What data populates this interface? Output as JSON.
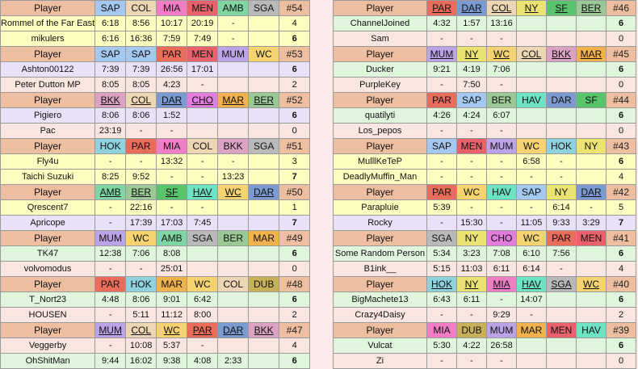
{
  "header_label": "Player",
  "colors": {
    "hdr": "#eebea0",
    "row_yellow": "#fdfdc0",
    "row_green": "#dff5dc",
    "row_lavender": "#e8e1f8",
    "row_pink": "#f9e6e0",
    "team": {
      "SAP": "#a4c8f0",
      "COL": "#edd6b4",
      "MIA": "#f07dc6",
      "MEN": "#e8616b",
      "AMB": "#7fd6a3",
      "SGA": "#b9b9b9",
      "PAR": "#ea6d5b",
      "MUM": "#bca2e6",
      "WC": "#f4d370",
      "BKK": "#dca2c3",
      "DAR": "#7a9ad1",
      "CHO": "#e27cdd",
      "MAR": "#f1b24d",
      "BER": "#9bc996",
      "HOK": "#8ed2de",
      "SF": "#58c46c",
      "HAV": "#6ee3c4",
      "DUB": "#c7b058",
      "NY": "#ebe371"
    }
  },
  "left": [
    {
      "num": "#54",
      "teams": [
        {
          "n": "SAP",
          "u": false
        },
        {
          "n": "COL",
          "u": false
        },
        {
          "n": "MIA",
          "u": false
        },
        {
          "n": "MEN",
          "u": false
        },
        {
          "n": "AMB",
          "u": false
        },
        {
          "n": "SGA",
          "u": false
        }
      ],
      "rows": [
        {
          "name": "Rommel of the Far East",
          "bg": "row_yellow",
          "cells": [
            "6:18",
            "8:56",
            "10:17",
            "20:19",
            "-",
            ""
          ],
          "count": "4",
          "max": false
        },
        {
          "name": "mikulers",
          "bg": "row_yellow",
          "cells": [
            "6:16",
            "16:36",
            "7:59",
            "7:49",
            "-",
            ""
          ],
          "count": "6",
          "max": true
        }
      ]
    },
    {
      "num": "#53",
      "teams": [
        {
          "n": "SAP",
          "u": false
        },
        {
          "n": "SAP",
          "u": false
        },
        {
          "n": "PAR",
          "u": false
        },
        {
          "n": "MEN",
          "u": false
        },
        {
          "n": "MUM",
          "u": false
        },
        {
          "n": "WC",
          "u": false
        }
      ],
      "rows": [
        {
          "name": "Ashton00122",
          "bg": "row_lavender",
          "cells": [
            "7:39",
            "7:39",
            "26:56",
            "17:01",
            "",
            ""
          ],
          "count": "6",
          "max": true
        },
        {
          "name": "Peter Dutton MP",
          "bg": "row_pink",
          "cells": [
            "8:05",
            "8:05",
            "4:23",
            "-",
            "",
            ""
          ],
          "count": "2",
          "max": false
        }
      ]
    },
    {
      "num": "#52",
      "teams": [
        {
          "n": "BKK",
          "u": true
        },
        {
          "n": "COL",
          "u": true
        },
        {
          "n": "DAR",
          "u": true
        },
        {
          "n": "CHO",
          "u": true
        },
        {
          "n": "MAR",
          "u": true
        },
        {
          "n": "BER",
          "u": true
        }
      ],
      "rows": [
        {
          "name": "Pigiero",
          "bg": "row_lavender",
          "cells": [
            "8:06",
            "8:06",
            "1:52",
            "",
            "",
            ""
          ],
          "count": "6",
          "max": true
        },
        {
          "name": "Pac",
          "bg": "row_pink",
          "cells": [
            "23:19",
            "-",
            "-",
            "",
            "",
            ""
          ],
          "count": "0",
          "max": false
        }
      ]
    },
    {
      "num": "#51",
      "teams": [
        {
          "n": "HOK",
          "u": false
        },
        {
          "n": "PAR",
          "u": false
        },
        {
          "n": "MIA",
          "u": false
        },
        {
          "n": "COL",
          "u": false
        },
        {
          "n": "BKK",
          "u": false
        },
        {
          "n": "SGA",
          "u": false
        }
      ],
      "rows": [
        {
          "name": "Fly4u",
          "bg": "row_yellow",
          "cells": [
            "-",
            "-",
            "13:32",
            "-",
            "-",
            ""
          ],
          "count": "3",
          "max": false
        },
        {
          "name": "Taichi Suzuki",
          "bg": "row_yellow",
          "cells": [
            "8:25",
            "9:52",
            "-",
            "-",
            "13:23",
            ""
          ],
          "count": "7",
          "max": true
        }
      ]
    },
    {
      "num": "#50",
      "teams": [
        {
          "n": "AMB",
          "u": true
        },
        {
          "n": "BER",
          "u": true
        },
        {
          "n": "SF",
          "u": true
        },
        {
          "n": "HAV",
          "u": true
        },
        {
          "n": "WC",
          "u": true
        },
        {
          "n": "DAR",
          "u": true
        }
      ],
      "rows": [
        {
          "name": "Qrescent7",
          "bg": "row_yellow",
          "cells": [
            "-",
            "22:16",
            "-",
            "-",
            "",
            ""
          ],
          "count": "1",
          "max": false
        },
        {
          "name": "Apricope",
          "bg": "row_lavender",
          "cells": [
            "-",
            "17:39",
            "17:03",
            "7:45",
            "",
            ""
          ],
          "count": "7",
          "max": true
        }
      ]
    },
    {
      "num": "#49",
      "teams": [
        {
          "n": "MUM",
          "u": false
        },
        {
          "n": "WC",
          "u": false
        },
        {
          "n": "AMB",
          "u": false
        },
        {
          "n": "SGA",
          "u": false
        },
        {
          "n": "BER",
          "u": false
        },
        {
          "n": "MAR",
          "u": false
        }
      ],
      "rows": [
        {
          "name": "TK47",
          "bg": "row_green",
          "cells": [
            "12:38",
            "7:06",
            "8:08",
            "",
            "",
            ""
          ],
          "count": "6",
          "max": true
        },
        {
          "name": "volvomodus",
          "bg": "row_pink",
          "cells": [
            "-",
            "-",
            "25:01",
            "",
            "",
            ""
          ],
          "count": "0",
          "max": false
        }
      ]
    },
    {
      "num": "#48",
      "teams": [
        {
          "n": "PAR",
          "u": false
        },
        {
          "n": "HOK",
          "u": false
        },
        {
          "n": "MAR",
          "u": false
        },
        {
          "n": "WC",
          "u": false
        },
        {
          "n": "COL",
          "u": false
        },
        {
          "n": "DUB",
          "u": false
        }
      ],
      "rows": [
        {
          "name": "T_Nort23",
          "bg": "row_green",
          "cells": [
            "4:48",
            "8:06",
            "9:01",
            "6:42",
            "",
            ""
          ],
          "count": "6",
          "max": true
        },
        {
          "name": "HOUSEN",
          "bg": "row_pink",
          "cells": [
            "-",
            "5:11",
            "11:12",
            "8:00",
            "",
            ""
          ],
          "count": "2",
          "max": false
        }
      ]
    },
    {
      "num": "#47",
      "teams": [
        {
          "n": "MUM",
          "u": true
        },
        {
          "n": "COL",
          "u": true
        },
        {
          "n": "WC",
          "u": true
        },
        {
          "n": "PAR",
          "u": true
        },
        {
          "n": "DAR",
          "u": true
        },
        {
          "n": "BKK",
          "u": true
        }
      ],
      "rows": [
        {
          "name": "Veggerby",
          "bg": "row_pink",
          "cells": [
            "-",
            "10:08",
            "5:37",
            "-",
            "",
            ""
          ],
          "count": "4",
          "max": false
        },
        {
          "name": "OhShitMan",
          "bg": "row_green",
          "cells": [
            "9:44",
            "16:02",
            "9:38",
            "4:08",
            "2:33",
            ""
          ],
          "count": "6",
          "max": true
        }
      ]
    }
  ],
  "right": [
    {
      "num": "#46",
      "teams": [
        {
          "n": "PAR",
          "u": true
        },
        {
          "n": "DAR",
          "u": true
        },
        {
          "n": "COL",
          "u": true
        },
        {
          "n": "NY",
          "u": true
        },
        {
          "n": "SF",
          "u": true
        },
        {
          "n": "BER",
          "u": true
        }
      ],
      "rows": [
        {
          "name": "ChannelJoined",
          "bg": "row_green",
          "cells": [
            "4:32",
            "1:57",
            "13:16",
            "",
            "",
            ""
          ],
          "count": "6",
          "max": true
        },
        {
          "name": "Sam",
          "bg": "row_pink",
          "cells": [
            "-",
            "-",
            "-",
            "",
            "",
            ""
          ],
          "count": "0",
          "max": false
        }
      ]
    },
    {
      "num": "#45",
      "teams": [
        {
          "n": "MUM",
          "u": true
        },
        {
          "n": "NY",
          "u": true
        },
        {
          "n": "WC",
          "u": true
        },
        {
          "n": "COL",
          "u": true
        },
        {
          "n": "BKK",
          "u": true
        },
        {
          "n": "MAR",
          "u": true
        }
      ],
      "rows": [
        {
          "name": "Ducker",
          "bg": "row_green",
          "cells": [
            "9:21",
            "4:19",
            "7:06",
            "",
            "",
            ""
          ],
          "count": "6",
          "max": true
        },
        {
          "name": "PurpleKey",
          "bg": "row_pink",
          "cells": [
            "-",
            "7:50",
            "-",
            "",
            "",
            ""
          ],
          "count": "0",
          "max": false
        }
      ]
    },
    {
      "num": "#44",
      "teams": [
        {
          "n": "PAR",
          "u": false
        },
        {
          "n": "SAP",
          "u": false
        },
        {
          "n": "BER",
          "u": false
        },
        {
          "n": "HAV",
          "u": false
        },
        {
          "n": "DAR",
          "u": false
        },
        {
          "n": "SF",
          "u": false
        }
      ],
      "rows": [
        {
          "name": "quatilyti",
          "bg": "row_green",
          "cells": [
            "4:26",
            "4:24",
            "6:07",
            "",
            "",
            ""
          ],
          "count": "6",
          "max": true
        },
        {
          "name": "Los_pepos",
          "bg": "row_pink",
          "cells": [
            "-",
            "-",
            "-",
            "",
            "",
            ""
          ],
          "count": "0",
          "max": false
        }
      ]
    },
    {
      "num": "#43",
      "teams": [
        {
          "n": "SAP",
          "u": false
        },
        {
          "n": "MEN",
          "u": false
        },
        {
          "n": "MUM",
          "u": false
        },
        {
          "n": "WC",
          "u": false
        },
        {
          "n": "HOK",
          "u": false
        },
        {
          "n": "NY",
          "u": false
        }
      ],
      "rows": [
        {
          "name": "MulllKeTeP",
          "bg": "row_yellow",
          "cells": [
            "-",
            "-",
            "-",
            "6:58",
            "-",
            ""
          ],
          "count": "6",
          "max": true
        },
        {
          "name": "DeadlyMuffin_Man",
          "bg": "row_yellow",
          "cells": [
            "-",
            "-",
            "-",
            "-",
            "-",
            ""
          ],
          "count": "4",
          "max": false
        }
      ]
    },
    {
      "num": "#42",
      "teams": [
        {
          "n": "PAR",
          "u": false
        },
        {
          "n": "WC",
          "u": false
        },
        {
          "n": "HAV",
          "u": false
        },
        {
          "n": "SAP",
          "u": false
        },
        {
          "n": "NY",
          "u": false
        },
        {
          "n": "DAR",
          "u": true
        }
      ],
      "rows": [
        {
          "name": "Parapluie",
          "bg": "row_yellow",
          "cells": [
            "5:39",
            "-",
            "-",
            "-",
            "6:14",
            "-"
          ],
          "count": "5",
          "max": false
        },
        {
          "name": "Rocky",
          "bg": "row_lavender",
          "cells": [
            "-",
            "15:30",
            "-",
            "11:05",
            "9:33",
            "3:29"
          ],
          "count": "7",
          "max": true
        }
      ]
    },
    {
      "num": "#41",
      "teams": [
        {
          "n": "SGA",
          "u": false
        },
        {
          "n": "NY",
          "u": false
        },
        {
          "n": "CHO",
          "u": false
        },
        {
          "n": "WC",
          "u": false
        },
        {
          "n": "PAR",
          "u": false
        },
        {
          "n": "MEN",
          "u": false
        }
      ],
      "rows": [
        {
          "name": "Some Random Person",
          "bg": "row_green",
          "cells": [
            "5:34",
            "3:23",
            "7:08",
            "6:10",
            "7:56",
            ""
          ],
          "count": "6",
          "max": true
        },
        {
          "name": "B1ink__",
          "bg": "row_pink",
          "cells": [
            "5:15",
            "11:03",
            "6:11",
            "6:14",
            "-",
            ""
          ],
          "count": "4",
          "max": false
        }
      ]
    },
    {
      "num": "#40",
      "teams": [
        {
          "n": "HOK",
          "u": true
        },
        {
          "n": "NY",
          "u": true
        },
        {
          "n": "MIA",
          "u": true
        },
        {
          "n": "HAV",
          "u": true
        },
        {
          "n": "SGA",
          "u": true
        },
        {
          "n": "WC",
          "u": true
        }
      ],
      "rows": [
        {
          "name": "BigMachete13",
          "bg": "row_green",
          "cells": [
            "6:43",
            "6:11",
            "-",
            "14:07",
            "",
            ""
          ],
          "count": "6",
          "max": true
        },
        {
          "name": "Crazy4Daisy",
          "bg": "row_pink",
          "cells": [
            "-",
            "-",
            "9:29",
            "-",
            "",
            ""
          ],
          "count": "2",
          "max": false
        }
      ]
    },
    {
      "num": "#39",
      "teams": [
        {
          "n": "MIA",
          "u": false
        },
        {
          "n": "DUB",
          "u": false
        },
        {
          "n": "MUM",
          "u": false
        },
        {
          "n": "MAR",
          "u": false
        },
        {
          "n": "MEN",
          "u": false
        },
        {
          "n": "HAV",
          "u": false
        }
      ],
      "rows": [
        {
          "name": "Vulcat",
          "bg": "row_green",
          "cells": [
            "5:30",
            "4:22",
            "26:58",
            "",
            "",
            ""
          ],
          "count": "6",
          "max": true
        },
        {
          "name": "Zi",
          "bg": "row_pink",
          "cells": [
            "-",
            "-",
            "-",
            "",
            "",
            ""
          ],
          "count": "0",
          "max": false
        }
      ]
    }
  ]
}
